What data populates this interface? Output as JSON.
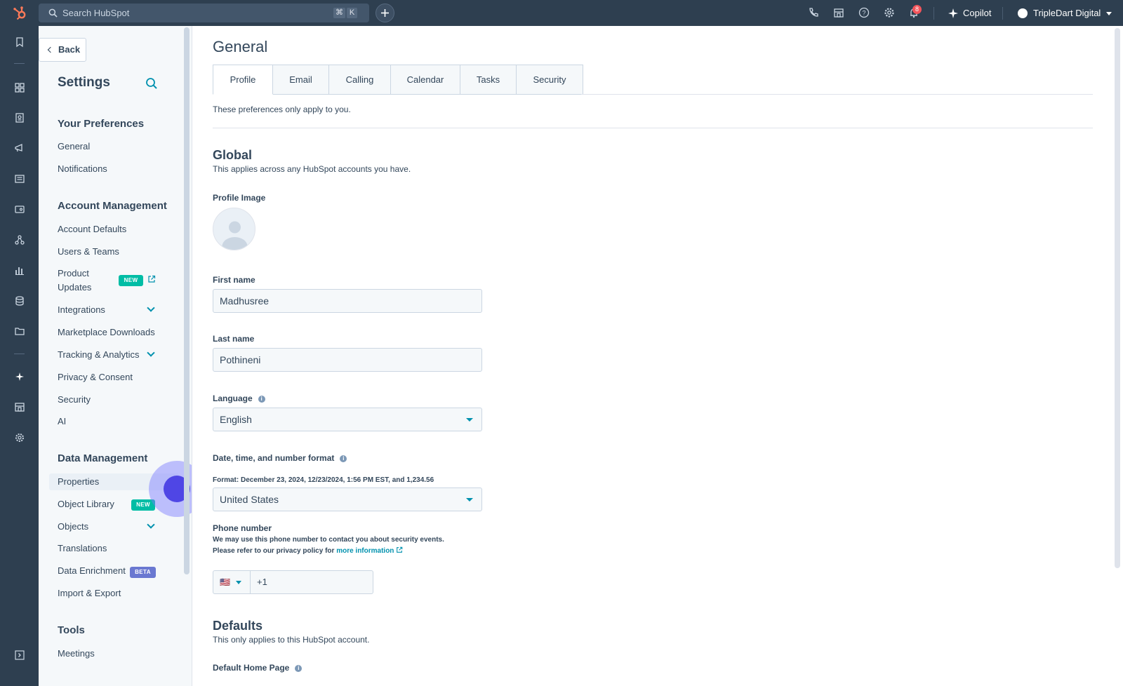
{
  "topbar": {
    "search_placeholder": "Search HubSpot",
    "shortcut_keys": [
      "⌘",
      "K"
    ],
    "notifications_count": "8",
    "copilot_label": "Copilot",
    "account_name": "TripleDart Digital",
    "icons": [
      "phone-icon",
      "marketplace-icon",
      "help-icon",
      "settings-icon",
      "notifications-icon"
    ]
  },
  "rail": {
    "icons": [
      "bookmark-icon",
      "dashboard-icon",
      "contacts-icon",
      "marketing-icon",
      "content-icon",
      "commerce-icon",
      "automation-icon",
      "reporting-icon",
      "data-icon",
      "library-icon",
      "copilot-icon",
      "marketplace-icon",
      "settings-icon",
      "collapse-icon"
    ]
  },
  "sidebar": {
    "back_label": "Back",
    "title": "Settings",
    "sections": [
      {
        "heading": "Your Preferences",
        "items": [
          {
            "label": "General"
          },
          {
            "label": "Notifications"
          }
        ]
      },
      {
        "heading": "Account Management",
        "items": [
          {
            "label": "Account Defaults"
          },
          {
            "label": "Users & Teams"
          },
          {
            "label": "Product Updates",
            "badge": "NEW"
          },
          {
            "label": "Integrations"
          },
          {
            "label": "Marketplace Downloads"
          },
          {
            "label": "Tracking & Analytics"
          },
          {
            "label": "Privacy & Consent"
          },
          {
            "label": "Security"
          },
          {
            "label": "AI"
          }
        ]
      },
      {
        "heading": "Data Management",
        "items": [
          {
            "label": "Properties"
          },
          {
            "label": "Object Library",
            "badge": "NEW"
          },
          {
            "label": "Objects"
          },
          {
            "label": "Translations"
          },
          {
            "label": "Data Enrichment",
            "badge": "BETA"
          },
          {
            "label": "Import & Export"
          }
        ]
      },
      {
        "heading": "Tools",
        "items": [
          {
            "label": "Meetings"
          }
        ]
      }
    ]
  },
  "main": {
    "title": "General",
    "tabs": [
      "Profile",
      "Email",
      "Calling",
      "Calendar",
      "Tasks",
      "Security"
    ],
    "active_tab": "Profile",
    "intro": "These preferences only apply to you.",
    "global": {
      "heading": "Global",
      "description": "This applies across any HubSpot accounts you have.",
      "profile_image_label": "Profile Image",
      "first_name_label": "First name",
      "first_name_value": "Madhusree",
      "last_name_label": "Last name",
      "last_name_value": "Pothineni",
      "language_label": "Language",
      "language_value": "English",
      "format_label": "Date, time, and number format",
      "format_example": "Format: December 23, 2024, 12/23/2024, 1:56 PM EST, and 1,234.56",
      "format_value": "United States",
      "phone_label": "Phone number",
      "phone_help_1": "We may use this phone number to contact you about security events.",
      "phone_help_2": "Please refer to our privacy policy for",
      "phone_help_link": "more information",
      "phone_flag": "🇺🇸",
      "phone_value": "+1"
    },
    "defaults": {
      "heading": "Defaults",
      "description": "This only applies to this HubSpot account.",
      "home_page_label": "Default Home Page"
    }
  },
  "colors": {
    "topbar": "#2e3f50",
    "accent": "#0091ae",
    "badge_new": "#00bda5",
    "badge_beta": "#6a78d1",
    "logo": "#ff7a59"
  }
}
